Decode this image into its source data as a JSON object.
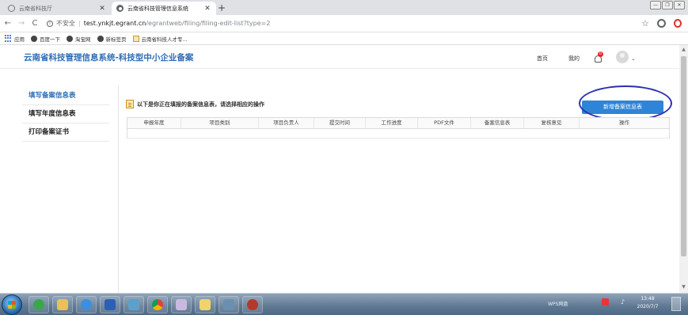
{
  "browser": {
    "tabs": [
      {
        "title": "云南省科技厅",
        "active": false
      },
      {
        "title": "云南省科技管理信息系统",
        "active": true
      }
    ],
    "new_tab": "+",
    "address": {
      "security": "不安全",
      "host": "test.ynkjt.egrant.cn",
      "path": "/egrantweb/filing/filing-edit-list?type=2"
    },
    "bookmarks": [
      {
        "label": "应用",
        "icon": "apps-icon"
      },
      {
        "label": "百度一下",
        "icon": "globe-icon"
      },
      {
        "label": "淘宝网",
        "icon": "globe-icon"
      },
      {
        "label": "新标签页",
        "icon": "globe-icon"
      },
      {
        "label": "云南省科技人才专...",
        "icon": "image-icon"
      }
    ]
  },
  "site": {
    "title": "云南省科技管理信息系统-科技型中小企业备案",
    "nav": {
      "home": "首页",
      "mine": "我的",
      "bell_badge": "0"
    }
  },
  "sidebar": {
    "items": [
      {
        "label": "填写备案信息表",
        "active": true
      },
      {
        "label": "填写年度信息表",
        "active": false
      },
      {
        "label": "打印备案证书",
        "active": false
      }
    ]
  },
  "main": {
    "tip": "以下是你正在填报的备案信息表，请选择相应的操作",
    "add_button": "新增备案信息表",
    "table": {
      "columns": [
        "申报年度",
        "项目类别",
        "项目负责人",
        "提交时间",
        "工作进度",
        "PDF文件",
        "备案信息表",
        "复核意见",
        "操作"
      ]
    }
  },
  "taskbar": {
    "tray": {
      "wps": "WPS网盘",
      "time": "13:48",
      "date": "2020/7/7"
    }
  },
  "colors": {
    "brand_blue": "#2f6db5",
    "button_blue": "#2e84d6",
    "annotation_circle": "#2d2fb0"
  }
}
